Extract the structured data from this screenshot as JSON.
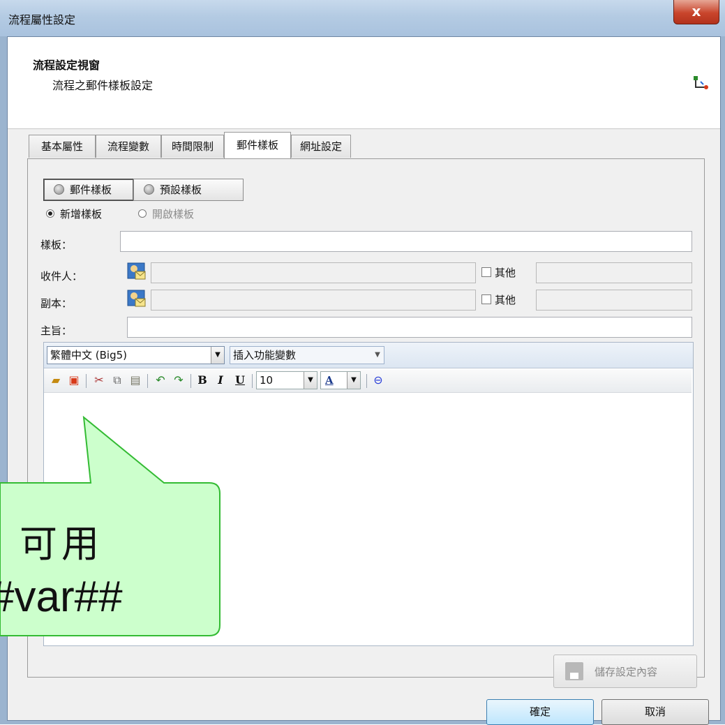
{
  "window": {
    "title": "流程屬性設定",
    "close_glyph": "x"
  },
  "header": {
    "title": "流程設定視窗",
    "subtitle": "流程之郵件樣板設定"
  },
  "tabs": [
    {
      "label": "基本屬性"
    },
    {
      "label": "流程變數"
    },
    {
      "label": "時間限制"
    },
    {
      "label": "郵件樣板",
      "active": true
    },
    {
      "label": "網址設定"
    }
  ],
  "template_mode": {
    "options": [
      "郵件樣板",
      "預設樣板"
    ],
    "selected": "郵件樣板"
  },
  "template_action": {
    "options": [
      "新增樣板",
      "開啟樣板"
    ],
    "selected": "新增樣板"
  },
  "form": {
    "template_label": "樣板：",
    "template_value": "",
    "recipient_label": "收件人：",
    "recipient_value": "",
    "recipient_other_label": "其他",
    "cc_label": "副本：",
    "cc_value": "",
    "cc_other_label": "其他",
    "subject_label": "主旨：",
    "subject_value": ""
  },
  "editor": {
    "encoding_value": "繁體中文 (Big5)",
    "insert_variable_value": "插入功能變數",
    "font_size_value": "10",
    "bold_label": "B",
    "italic_label": "I",
    "underline_label": "U",
    "color_label": "A"
  },
  "buttons": {
    "save_settings": "儲存設定內容",
    "ok": "確定",
    "cancel": "取消"
  },
  "callout": {
    "line1": "可用",
    "line2": "#var##"
  },
  "colors": {
    "callout_fill": "#ccffcc",
    "callout_border": "#33bb33",
    "ok_button": "#bee6fd"
  }
}
